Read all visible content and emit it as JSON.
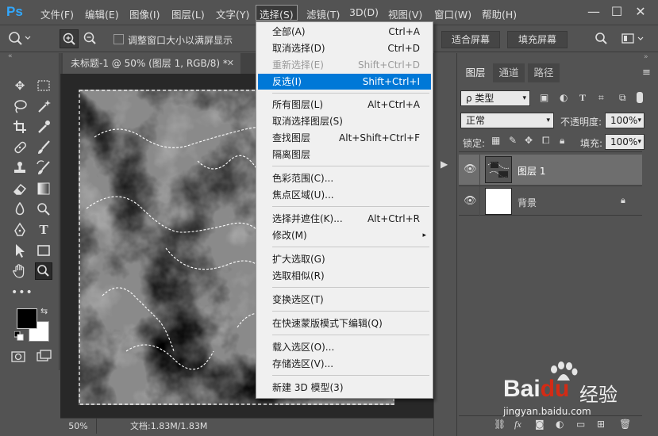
{
  "app": {
    "logo": "Ps"
  },
  "menubar": {
    "items": [
      "文件(F)",
      "编辑(E)",
      "图像(I)",
      "图层(L)",
      "文字(Y)",
      "选择(S)",
      "滤镜(T)",
      "3D(D)",
      "视图(V)",
      "窗口(W)",
      "帮助(H)"
    ],
    "window_controls": [
      "—",
      "☐",
      "✕"
    ]
  },
  "options_bar": {
    "checkbox_label": "调整窗口大小以满屏显示",
    "fit_screen": "适合屏幕",
    "fill_screen": "填充屏幕"
  },
  "document": {
    "tab_title": "未标题-1 @ 50% (图层 1, RGB/8) *",
    "zoom": "50%",
    "doc_info": "文档:1.83M/1.83M"
  },
  "select_menu": {
    "items": [
      {
        "label": "全部(A)",
        "shortcut": "Ctrl+A",
        "state": "normal"
      },
      {
        "label": "取消选择(D)",
        "shortcut": "Ctrl+D",
        "state": "normal"
      },
      {
        "label": "重新选择(E)",
        "shortcut": "Shift+Ctrl+D",
        "state": "disabled"
      },
      {
        "label": "反选(I)",
        "shortcut": "Shift+Ctrl+I",
        "state": "highlighted"
      },
      {
        "label": "所有图层(L)",
        "shortcut": "Alt+Ctrl+A",
        "state": "normal"
      },
      {
        "label": "取消选择图层(S)",
        "shortcut": "",
        "state": "normal"
      },
      {
        "label": "查找图层",
        "shortcut": "Alt+Shift+Ctrl+F",
        "state": "normal"
      },
      {
        "label": "隔离图层",
        "shortcut": "",
        "state": "normal"
      },
      {
        "label": "色彩范围(C)...",
        "shortcut": "",
        "state": "normal"
      },
      {
        "label": "焦点区域(U)...",
        "shortcut": "",
        "state": "normal"
      },
      {
        "label": "选择并遮住(K)...",
        "shortcut": "Alt+Ctrl+R",
        "state": "normal"
      },
      {
        "label": "修改(M)",
        "shortcut": "▸",
        "state": "normal"
      },
      {
        "label": "扩大选取(G)",
        "shortcut": "",
        "state": "normal"
      },
      {
        "label": "选取相似(R)",
        "shortcut": "",
        "state": "normal"
      },
      {
        "label": "变换选区(T)",
        "shortcut": "",
        "state": "normal"
      },
      {
        "label": "在快速蒙版模式下编辑(Q)",
        "shortcut": "",
        "state": "normal"
      },
      {
        "label": "载入选区(O)...",
        "shortcut": "",
        "state": "normal"
      },
      {
        "label": "存储选区(V)...",
        "shortcut": "",
        "state": "normal"
      },
      {
        "label": "新建 3D 模型(3)",
        "shortcut": "",
        "state": "normal"
      }
    ]
  },
  "layers_panel": {
    "tabs": [
      "图层",
      "通道",
      "路径"
    ],
    "filter_kind": "ρ 类型",
    "blend_mode": "正常",
    "opacity_label": "不透明度:",
    "opacity_value": "100%",
    "lock_label": "锁定:",
    "fill_label": "填充:",
    "fill_value": "100%",
    "layers": [
      {
        "name": "图层 1",
        "selected": true
      },
      {
        "name": "背景",
        "selected": false
      }
    ]
  },
  "watermark": {
    "brand": "Bai",
    "brand2": "du",
    "product": "经验",
    "url": "jingyan.baidu.com"
  },
  "colors": {
    "highlight": "#0078d7",
    "ps_blue": "#31a8ff",
    "baidu_red": "#de2810"
  }
}
